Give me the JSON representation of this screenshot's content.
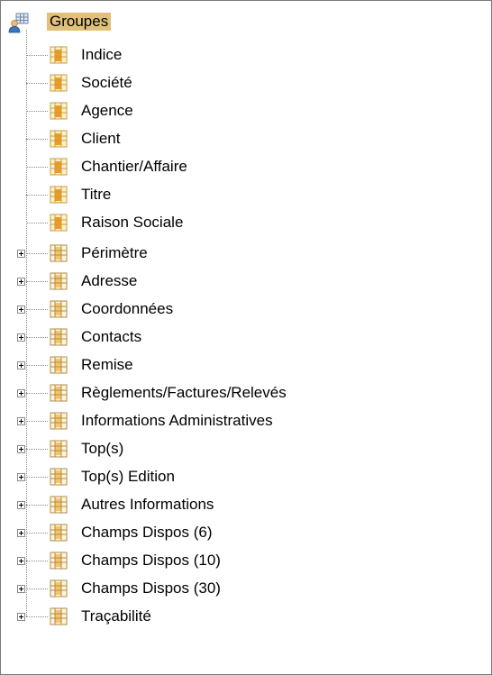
{
  "tree": {
    "root": {
      "label": "Groupes",
      "icon": "group-users-icon"
    },
    "leaf_items": [
      {
        "label": "Indice",
        "icon": "field-table-icon"
      },
      {
        "label": "Société",
        "icon": "field-table-icon"
      },
      {
        "label": "Agence",
        "icon": "field-table-icon"
      },
      {
        "label": "Client",
        "icon": "field-table-icon"
      },
      {
        "label": "Chantier/Affaire",
        "icon": "field-table-icon"
      },
      {
        "label": "Titre",
        "icon": "field-table-icon"
      },
      {
        "label": "Raison Sociale",
        "icon": "field-table-icon"
      }
    ],
    "group_items": [
      {
        "label": "Périmètre",
        "icon": "group-table-icon",
        "expanded": false
      },
      {
        "label": "Adresse",
        "icon": "group-table-icon",
        "expanded": false
      },
      {
        "label": "Coordonnées",
        "icon": "group-table-icon",
        "expanded": false
      },
      {
        "label": "Contacts",
        "icon": "group-table-icon",
        "expanded": false
      },
      {
        "label": "Remise",
        "icon": "group-table-icon",
        "expanded": false
      },
      {
        "label": "Règlements/Factures/Relevés",
        "icon": "group-table-icon",
        "expanded": false
      },
      {
        "label": "Informations Administratives",
        "icon": "group-table-icon",
        "expanded": false
      },
      {
        "label": "Top(s)",
        "icon": "group-table-icon",
        "expanded": false
      },
      {
        "label": "Top(s) Edition",
        "icon": "group-table-icon",
        "expanded": false
      },
      {
        "label": "Autres Informations",
        "icon": "group-table-icon",
        "expanded": false
      },
      {
        "label": "Champs Dispos (6)",
        "icon": "group-table-icon",
        "expanded": false
      },
      {
        "label": "Champs Dispos (10)",
        "icon": "group-table-icon",
        "expanded": false
      },
      {
        "label": "Champs Dispos (30)",
        "icon": "group-table-icon",
        "expanded": false
      },
      {
        "label": "Traçabilité",
        "icon": "group-table-icon",
        "expanded": false
      }
    ]
  },
  "colors": {
    "root_highlight": "#e0c07a",
    "tree_lines": "#8a8a8a",
    "border": "#7a7a7a"
  }
}
